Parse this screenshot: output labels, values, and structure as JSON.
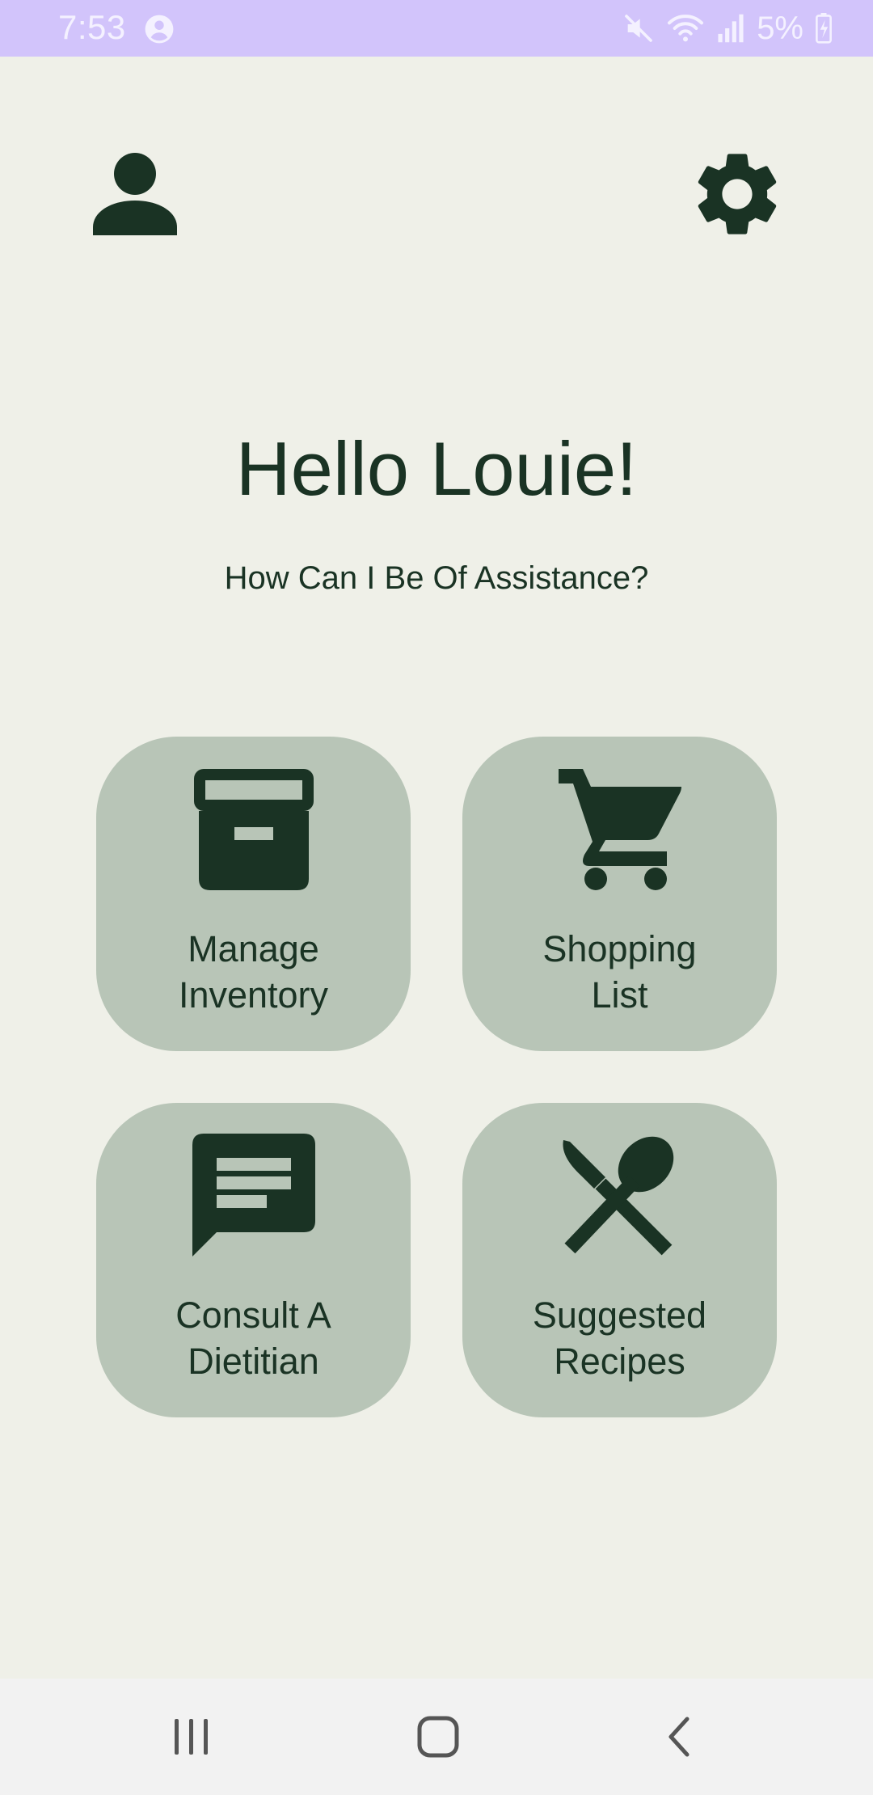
{
  "status_bar": {
    "time": "7:53",
    "battery_text": "5%",
    "background": "#d2c4fb",
    "icons": [
      "account-circle-icon",
      "mute-icon",
      "wifi-icon",
      "signal-icon",
      "battery-charging-icon"
    ]
  },
  "header": {
    "profile_icon": "person-icon",
    "settings_icon": "gear-icon"
  },
  "greeting": {
    "title": "Hello Louie!",
    "subtitle": "How Can I Be Of Assistance?"
  },
  "tiles": [
    {
      "label": "Manage\nInventory",
      "icon": "archive-box-icon"
    },
    {
      "label": "Shopping\nList",
      "icon": "shopping-cart-icon"
    },
    {
      "label": "Consult A\nDietitian",
      "icon": "chat-message-icon"
    },
    {
      "label": "Suggested\nRecipes",
      "icon": "knife-spoon-icon"
    }
  ],
  "nav_bar": {
    "buttons": [
      "recents-icon",
      "home-icon",
      "back-icon"
    ]
  },
  "colors": {
    "background": "#eff0e8",
    "tile": "#b8c5b7",
    "primary_dark": "#1a3324",
    "status_bar": "#d2c4fb",
    "nav_bar": "#f2f2f2"
  }
}
